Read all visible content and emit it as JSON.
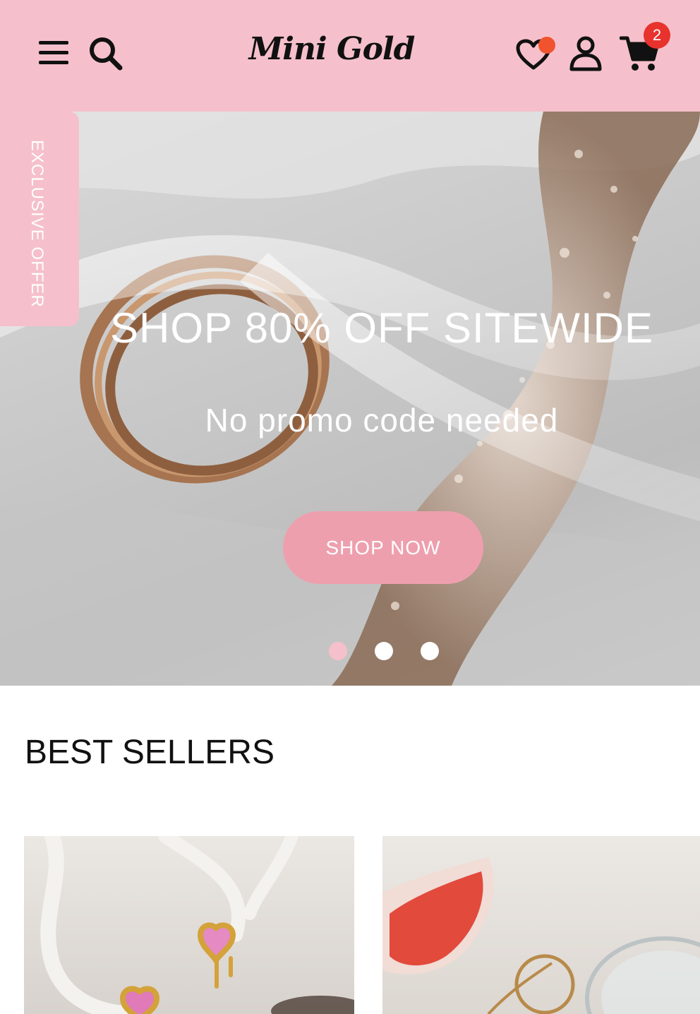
{
  "header": {
    "logo": "Mini Gold",
    "cart_count": "2",
    "icons": [
      "menu-icon",
      "search-icon",
      "heart-icon",
      "user-icon",
      "cart-icon"
    ],
    "background": "#f5c0cb",
    "notification_dot_color": "#f0532d",
    "badge_color": "#e8322d"
  },
  "hero": {
    "side_tab": "EXCLUSIVE OFFER",
    "title": "SHOP 80% OFF SITEWIDE",
    "subtitle": "No promo code needed",
    "cta_label": "SHOP NOW",
    "cta_color": "#ee9fae",
    "carousel_slide_count": 3,
    "carousel_active_index": 0
  },
  "best_sellers": {
    "title": "BEST SELLERS"
  }
}
